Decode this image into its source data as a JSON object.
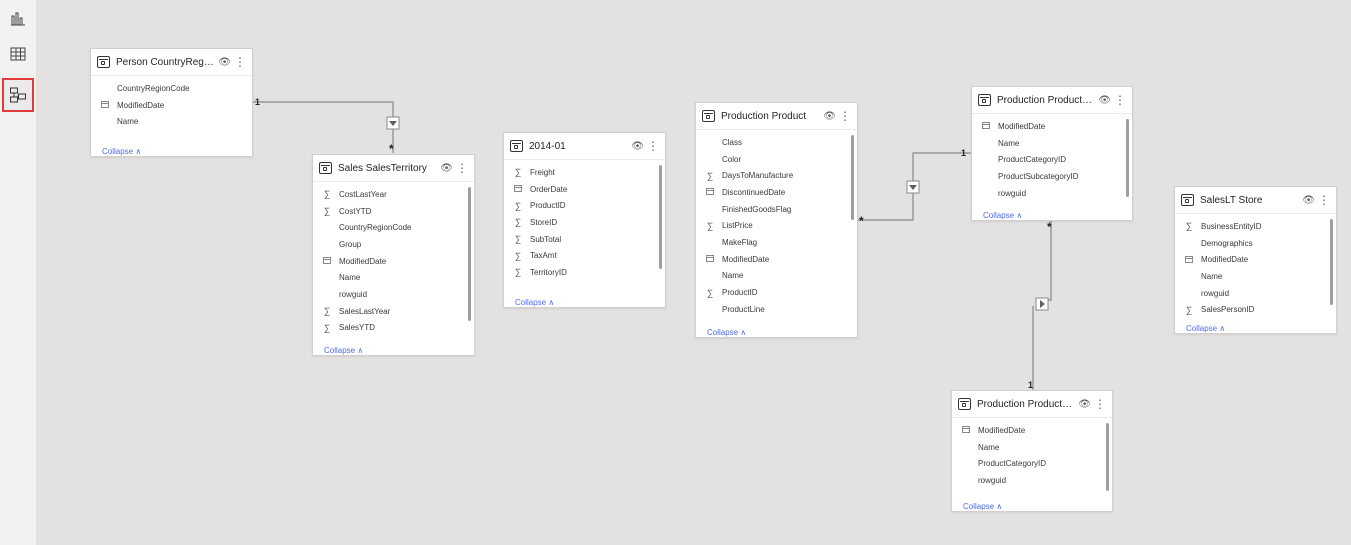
{
  "colors": {
    "accent": "#4f6bed",
    "selected_border": "#e13b3b",
    "line": "#8a8886"
  },
  "rail": {
    "items": [
      {
        "name": "report-view",
        "icon": "bar-chart-icon"
      },
      {
        "name": "data-view",
        "icon": "table-grid-icon"
      },
      {
        "name": "model-view",
        "icon": "model-diagram-icon",
        "selected": true
      }
    ]
  },
  "collapse_label": "Collapse",
  "tables": {
    "person_countryregion": {
      "title": "Person CountryRegion",
      "rows": [
        {
          "icon": "none",
          "label": "CountryRegionCode"
        },
        {
          "icon": "calendar",
          "label": "ModifiedDate"
        },
        {
          "icon": "none",
          "label": "Name"
        }
      ]
    },
    "sales_salesterritory": {
      "title": "Sales SalesTerritory",
      "rows": [
        {
          "icon": "sigma",
          "label": "CostLastYear"
        },
        {
          "icon": "sigma",
          "label": "CostYTD"
        },
        {
          "icon": "none",
          "label": "CountryRegionCode"
        },
        {
          "icon": "none",
          "label": "Group"
        },
        {
          "icon": "calendar",
          "label": "ModifiedDate"
        },
        {
          "icon": "none",
          "label": "Name"
        },
        {
          "icon": "none",
          "label": "rowguid"
        },
        {
          "icon": "sigma",
          "label": "SalesLastYear"
        },
        {
          "icon": "sigma",
          "label": "SalesYTD"
        }
      ]
    },
    "t2014_01": {
      "title": "2014-01",
      "rows": [
        {
          "icon": "sigma",
          "label": "Freight"
        },
        {
          "icon": "calendar",
          "label": "OrderDate"
        },
        {
          "icon": "sigma",
          "label": "ProductID"
        },
        {
          "icon": "sigma",
          "label": "StoreID"
        },
        {
          "icon": "sigma",
          "label": "SubTotal"
        },
        {
          "icon": "sigma",
          "label": "TaxAmt"
        },
        {
          "icon": "sigma",
          "label": "TerritoryID"
        }
      ]
    },
    "production_product": {
      "title": "Production Product",
      "rows": [
        {
          "icon": "none",
          "label": "Class"
        },
        {
          "icon": "none",
          "label": "Color"
        },
        {
          "icon": "sigma",
          "label": "DaysToManufacture"
        },
        {
          "icon": "calendar",
          "label": "DiscontinuedDate"
        },
        {
          "icon": "none",
          "label": "FinishedGoodsFlag"
        },
        {
          "icon": "sigma",
          "label": "ListPrice"
        },
        {
          "icon": "none",
          "label": "MakeFlag"
        },
        {
          "icon": "calendar",
          "label": "ModifiedDate"
        },
        {
          "icon": "none",
          "label": "Name"
        },
        {
          "icon": "sigma",
          "label": "ProductID"
        },
        {
          "icon": "none",
          "label": "ProductLine"
        }
      ]
    },
    "production_productsubcategory": {
      "title": "Production ProductS...",
      "rows": [
        {
          "icon": "calendar",
          "label": "ModifiedDate"
        },
        {
          "icon": "none",
          "label": "Name"
        },
        {
          "icon": "none",
          "label": "ProductCategoryID"
        },
        {
          "icon": "none",
          "label": "ProductSubcategoryID"
        },
        {
          "icon": "none",
          "label": "rowguid"
        }
      ]
    },
    "saleslt_store": {
      "title": "SalesLT Store",
      "rows": [
        {
          "icon": "sigma",
          "label": "BusinessEntityID"
        },
        {
          "icon": "none",
          "label": "Demographics"
        },
        {
          "icon": "calendar",
          "label": "ModifiedDate"
        },
        {
          "icon": "none",
          "label": "Name"
        },
        {
          "icon": "none",
          "label": "rowguid"
        },
        {
          "icon": "sigma",
          "label": "SalesPersonID"
        }
      ]
    },
    "production_productcategory": {
      "title": "Production ProductC...",
      "rows": [
        {
          "icon": "calendar",
          "label": "ModifiedDate"
        },
        {
          "icon": "none",
          "label": "Name"
        },
        {
          "icon": "none",
          "label": "ProductCategoryID"
        },
        {
          "icon": "none",
          "label": "rowguid"
        }
      ]
    }
  },
  "relationships": [
    {
      "from": "person_countryregion",
      "to": "sales_salesterritory",
      "from_card": "1",
      "to_card": "*"
    },
    {
      "from": "production_product",
      "to": "production_productsubcategory",
      "from_card": "*",
      "to_card": "1"
    },
    {
      "from": "production_productsubcategory",
      "to": "production_productcategory",
      "from_card": "*",
      "to_card": "1"
    }
  ]
}
